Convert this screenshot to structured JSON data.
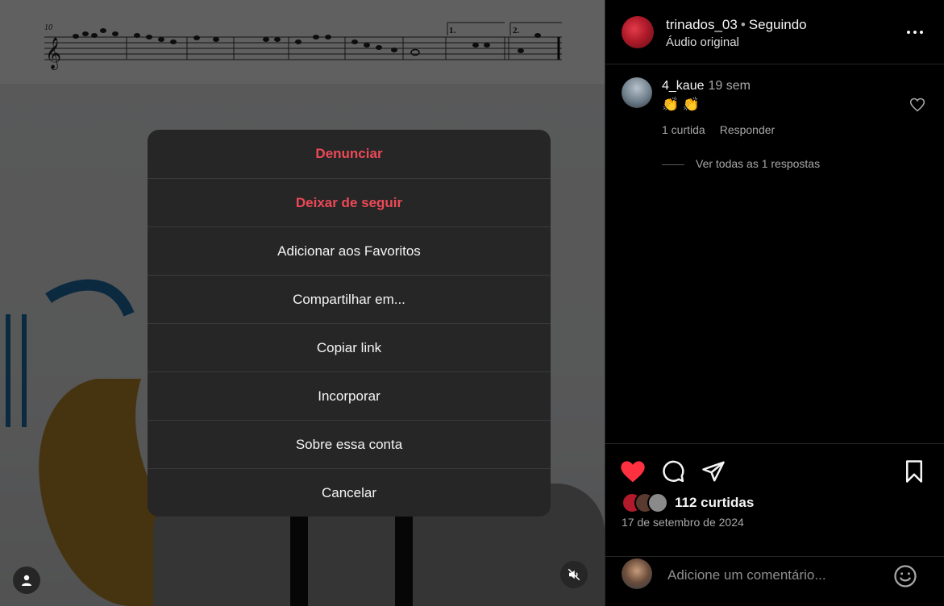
{
  "modal": {
    "items": [
      {
        "label": "Denunciar",
        "danger": true
      },
      {
        "label": "Deixar de seguir",
        "danger": true
      },
      {
        "label": "Adicionar aos Favoritos",
        "danger": false
      },
      {
        "label": "Compartilhar em...",
        "danger": false
      },
      {
        "label": "Copiar link",
        "danger": false
      },
      {
        "label": "Incorporar",
        "danger": false
      },
      {
        "label": "Sobre essa conta",
        "danger": false
      },
      {
        "label": "Cancelar",
        "danger": false
      }
    ]
  },
  "header": {
    "username": "trinados_03",
    "separator": "•",
    "following": "Seguindo",
    "audio": "Áudio original"
  },
  "comment": {
    "username": "4_kaue",
    "time": "19 sem",
    "text": "👏 👏",
    "likes": "1 curtida",
    "reply": "Responder",
    "view_replies": "Ver todas as 1 respostas"
  },
  "post": {
    "likes": "112 curtidas",
    "date": "17 de setembro de 2024",
    "liked": true
  },
  "add_comment": {
    "placeholder": "Adicione um comentário..."
  },
  "colors": {
    "danger": "#ed4956",
    "like_red": "#ff3040",
    "modal_bg": "#262626"
  },
  "icons": [
    "ellipsis-icon",
    "heart-icon",
    "comment-icon",
    "share-icon",
    "bookmark-icon",
    "emoji-icon",
    "mute-icon",
    "user-tag-icon"
  ]
}
